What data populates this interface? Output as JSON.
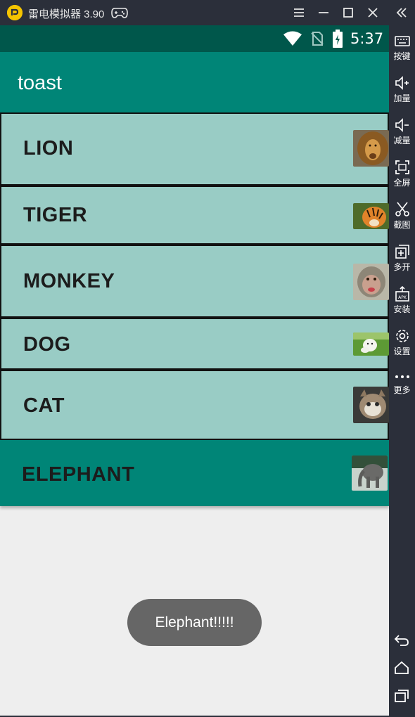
{
  "emulator": {
    "title": "雷电模拟器 3.90",
    "side_buttons": [
      {
        "icon": "keyboard-icon",
        "label": "按键"
      },
      {
        "icon": "volume-up-icon",
        "label": "加量"
      },
      {
        "icon": "volume-down-icon",
        "label": "减量"
      },
      {
        "icon": "fullscreen-icon",
        "label": "全屏"
      },
      {
        "icon": "scissors-icon",
        "label": "截图"
      },
      {
        "icon": "multi-instance-icon",
        "label": "多开"
      },
      {
        "icon": "apk-install-icon",
        "label": "安装"
      },
      {
        "icon": "gear-icon",
        "label": "设置"
      },
      {
        "icon": "more-dots-icon",
        "label": "更多"
      }
    ]
  },
  "status_bar": {
    "time": "5:37"
  },
  "app": {
    "title": "toast"
  },
  "list": {
    "items": [
      {
        "label": "LION",
        "thumb": "lion"
      },
      {
        "label": "TIGER",
        "thumb": "tiger"
      },
      {
        "label": "MONKEY",
        "thumb": "monkey"
      },
      {
        "label": "DOG",
        "thumb": "dog"
      },
      {
        "label": "CAT",
        "thumb": "cat"
      },
      {
        "label": "ELEPHANT",
        "thumb": "elephant"
      }
    ],
    "selected": "ELEPHANT"
  },
  "toast": {
    "message": "Elephant!!!!!"
  },
  "colors": {
    "primary": "#008577",
    "primary_dark": "#00574b",
    "list_item_bg": "#99ccc5",
    "emulator_chrome": "#2b2f3a"
  }
}
